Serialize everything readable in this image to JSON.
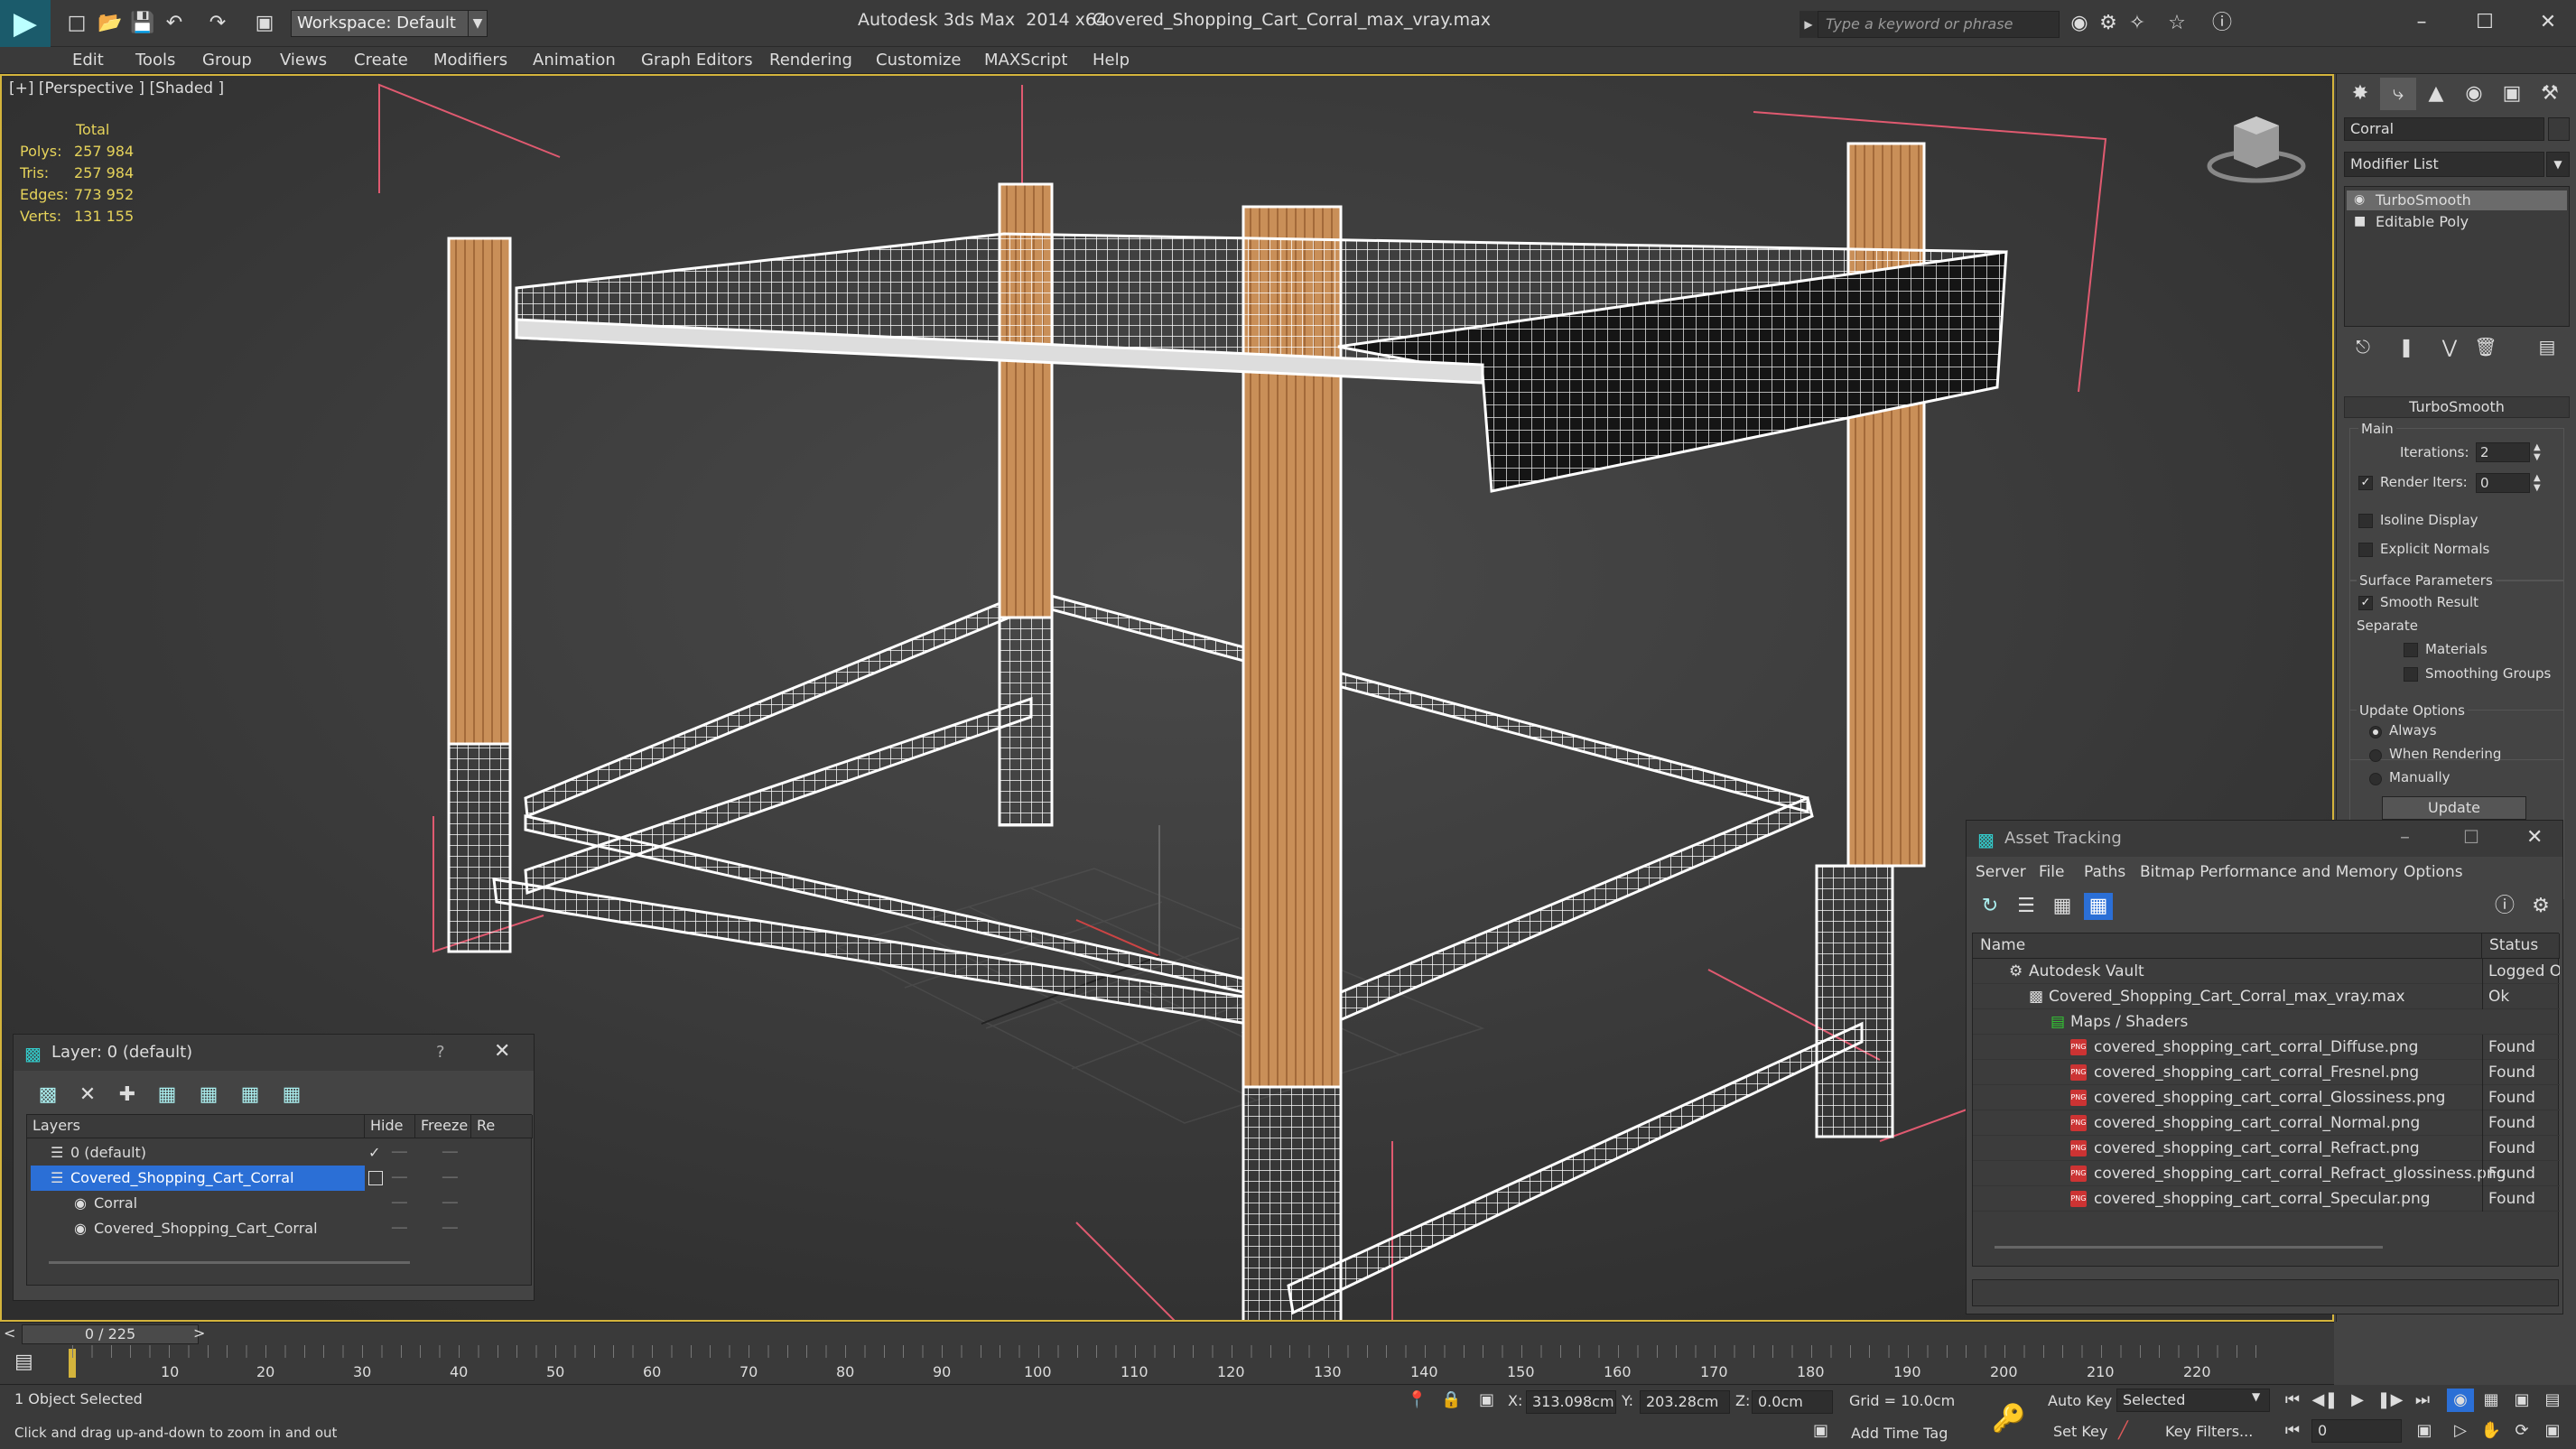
{
  "titlebar": {
    "workspace": "Workspace: Default",
    "app_title": "Autodesk 3ds Max  2014 x64",
    "file_title": "Covered_Shopping_Cart_Corral_max_vray.max",
    "search_placeholder": "Type a keyword or phrase"
  },
  "menu": [
    "Edit",
    "Tools",
    "Group",
    "Views",
    "Create",
    "Modifiers",
    "Animation",
    "Graph Editors",
    "Rendering",
    "Customize",
    "MAXScript",
    "Help"
  ],
  "viewport": {
    "label": "[+] [Perspective ] [Shaded ]",
    "stats": {
      "total_label": "Total",
      "rows": [
        {
          "label": "Polys:",
          "value": "257 984"
        },
        {
          "label": "Tris:",
          "value": "257 984"
        },
        {
          "label": "Edges:",
          "value": "773 952"
        },
        {
          "label": "Verts:",
          "value": "131 155"
        }
      ]
    }
  },
  "command_panel": {
    "object_name": "Corral",
    "modifier_list": "Modifier List",
    "stack": [
      "TurboSmooth",
      "Editable Poly"
    ],
    "rollout_title": "TurboSmooth",
    "main_group": "Main",
    "iterations_label": "Iterations:",
    "iterations_value": "2",
    "render_iters_label": "Render Iters:",
    "render_iters_value": "0",
    "render_iters_checked": true,
    "isoline_label": "Isoline Display",
    "explicit_normals_label": "Explicit Normals",
    "surface_group": "Surface Parameters",
    "smooth_result_label": "Smooth Result",
    "separate_label": "Separate",
    "materials_label": "Materials",
    "smoothing_groups_label": "Smoothing Groups",
    "update_group": "Update Options",
    "update_options": [
      "Always",
      "When Rendering",
      "Manually"
    ],
    "update_button": "Update"
  },
  "layer_dialog": {
    "title": "Layer: 0 (default)",
    "help": "?",
    "columns": [
      "Layers",
      "Hide",
      "Freeze",
      "Re"
    ],
    "rows": [
      {
        "name": "0 (default)",
        "indent": 1,
        "selected": false,
        "active": true
      },
      {
        "name": "Covered_Shopping_Cart_Corral",
        "indent": 1,
        "selected": true,
        "active": false
      },
      {
        "name": "Corral",
        "indent": 2,
        "selected": false,
        "active": false
      },
      {
        "name": "Covered_Shopping_Cart_Corral",
        "indent": 2,
        "selected": false,
        "active": false
      }
    ]
  },
  "asset_dialog": {
    "title": "Asset Tracking",
    "menu": [
      "Server",
      "File",
      "Paths",
      "Bitmap Performance and Memory",
      "Options"
    ],
    "columns": [
      "Name",
      "Status"
    ],
    "rows": [
      {
        "name": "Autodesk Vault",
        "status": "Logged Out",
        "indent": 1,
        "icon": "vault"
      },
      {
        "name": "Covered_Shopping_Cart_Corral_max_vray.max",
        "status": "Ok",
        "indent": 2,
        "icon": "file"
      },
      {
        "name": "Maps / Shaders",
        "status": "",
        "indent": 3,
        "icon": "maps"
      },
      {
        "name": "covered_shopping_cart_corral_Diffuse.png",
        "status": "Found",
        "indent": 4,
        "icon": "png"
      },
      {
        "name": "covered_shopping_cart_corral_Fresnel.png",
        "status": "Found",
        "indent": 4,
        "icon": "png"
      },
      {
        "name": "covered_shopping_cart_corral_Glossiness.png",
        "status": "Found",
        "indent": 4,
        "icon": "png"
      },
      {
        "name": "covered_shopping_cart_corral_Normal.png",
        "status": "Found",
        "indent": 4,
        "icon": "png"
      },
      {
        "name": "covered_shopping_cart_corral_Refract.png",
        "status": "Found",
        "indent": 4,
        "icon": "png"
      },
      {
        "name": "covered_shopping_cart_corral_Refract_glossiness.png",
        "status": "Found",
        "indent": 4,
        "icon": "png"
      },
      {
        "name": "covered_shopping_cart_corral_Specular.png",
        "status": "Found",
        "indent": 4,
        "icon": "png"
      }
    ]
  },
  "timeline": {
    "frame": "0 / 225",
    "ticks": [
      "10",
      "20",
      "30",
      "40",
      "50",
      "60",
      "70",
      "80",
      "90",
      "100",
      "110",
      "120",
      "130",
      "140",
      "150",
      "160",
      "170",
      "180",
      "190",
      "200",
      "210",
      "220"
    ]
  },
  "statusbar": {
    "selection": "1 Object Selected",
    "prompt": "Click and drag up-and-down to zoom in and out",
    "x_label": "X:",
    "x_value": "313.098cm",
    "y_label": "Y:",
    "y_value": "203.28cm",
    "z_label": "Z:",
    "z_value": "0.0cm",
    "grid": "Grid = 10.0cm",
    "add_time_tag": "Add Time Tag",
    "auto_key": "Auto Key",
    "set_key": "Set Key",
    "selected": "Selected",
    "key_filters": "Key Filters...",
    "frame_field": "0"
  },
  "colors": {
    "viewport_border": "#d4b43c",
    "stats_text": "#e6d35a",
    "selection_blue": "#2b6fd6",
    "wood": "#c98f58"
  }
}
